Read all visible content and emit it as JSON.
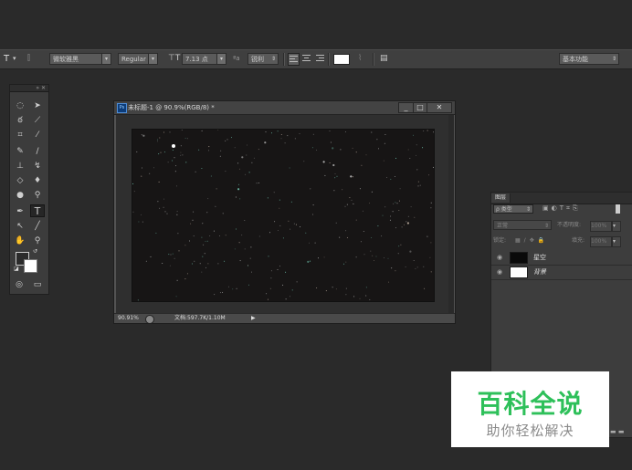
{
  "options_bar": {
    "tool_glyph": "T",
    "tool_arrow": "▾",
    "font_family": "微软雅黑",
    "font_style": "Regular",
    "font_size": "7.13 点",
    "aa_label": "ªa",
    "aa_mode": "锐利",
    "workspace": "基本功能"
  },
  "document": {
    "title": "未标题-1 @ 90.9%(RGB/8) *",
    "ps_badge": "Ps",
    "zoom": "90.91%",
    "doc_info": "文档:597.7K/1.10M",
    "btn_min": "_",
    "btn_max": "□",
    "btn_close": "✕"
  },
  "layers_panel": {
    "tab": "图层",
    "filter_kind": "ρ 类型",
    "blend_mode": "正常",
    "opacity_label": "不透明度:",
    "opacity_value": "100%",
    "lock_label": "锁定:",
    "fill_label": "填充:",
    "fill_value": "100%",
    "layers": [
      {
        "name": "星空",
        "thumb_color": "#0a0a0a"
      },
      {
        "name": "背景",
        "thumb_color": "#ffffff"
      }
    ]
  },
  "watermark": {
    "title": "百科全说",
    "subtitle": "助你轻松解决"
  }
}
